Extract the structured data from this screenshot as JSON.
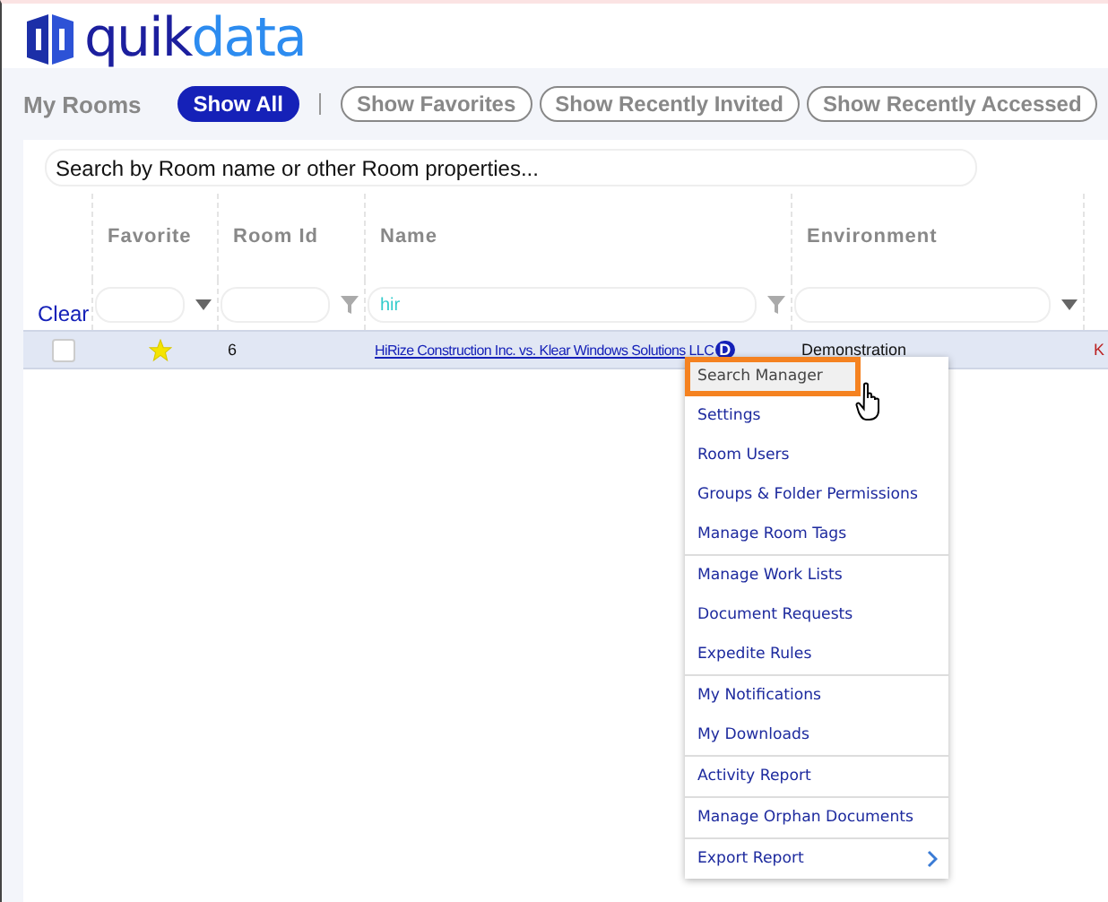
{
  "logo": {
    "text_dark": "quik",
    "text_light": "data"
  },
  "room_filter": {
    "title": "My Rooms",
    "options": [
      {
        "label": "Show All",
        "selected": true
      },
      {
        "label": "Show Favorites",
        "selected": false
      },
      {
        "label": "Show Recently Invited",
        "selected": false
      },
      {
        "label": "Show Recently Accessed",
        "selected": false
      }
    ]
  },
  "search": {
    "placeholder": "Search by Room name or other Room properties..."
  },
  "table": {
    "clear_label": "Clear",
    "columns": [
      {
        "kind": "checkbox"
      },
      {
        "label": "Favorite",
        "kind": "dropdown"
      },
      {
        "label": "Room Id",
        "kind": "text"
      },
      {
        "label": "Name",
        "kind": "text",
        "value": "hir"
      },
      {
        "label": "Environment",
        "kind": "dropdown"
      },
      {
        "kind": "plain"
      }
    ],
    "rows": [
      {
        "selected": true,
        "checked": false,
        "favorite": true,
        "room_id": "6",
        "name": "HiRize Construction Inc. vs. Klear Windows Solutions LLC",
        "badge": "D",
        "environment": "Demonstration",
        "column_5": "K"
      }
    ]
  },
  "context_menu": {
    "groups": [
      [
        {
          "label": "Search Manager",
          "selected": true,
          "submenu": false
        },
        {
          "label": "Settings",
          "selected": false,
          "submenu": false
        },
        {
          "label": "Room Users",
          "selected": false,
          "submenu": false
        },
        {
          "label": "Groups & Folder Permissions",
          "selected": false,
          "submenu": false
        },
        {
          "label": "Manage Room Tags",
          "selected": false,
          "submenu": false
        }
      ],
      [
        {
          "label": "Manage Work Lists",
          "selected": false,
          "submenu": false
        },
        {
          "label": "Document Requests",
          "selected": false,
          "submenu": false
        },
        {
          "label": "Expedite Rules",
          "selected": false,
          "submenu": false
        }
      ],
      [
        {
          "label": "My Notifications",
          "selected": false,
          "submenu": false
        },
        {
          "label": "My Downloads",
          "selected": false,
          "submenu": false
        }
      ],
      [
        {
          "label": "Activity Report",
          "selected": false,
          "submenu": false
        }
      ],
      [
        {
          "label": "Manage Orphan Documents",
          "selected": false,
          "submenu": false
        }
      ],
      [
        {
          "label": "Export Report",
          "selected": false,
          "submenu": true
        }
      ]
    ]
  }
}
